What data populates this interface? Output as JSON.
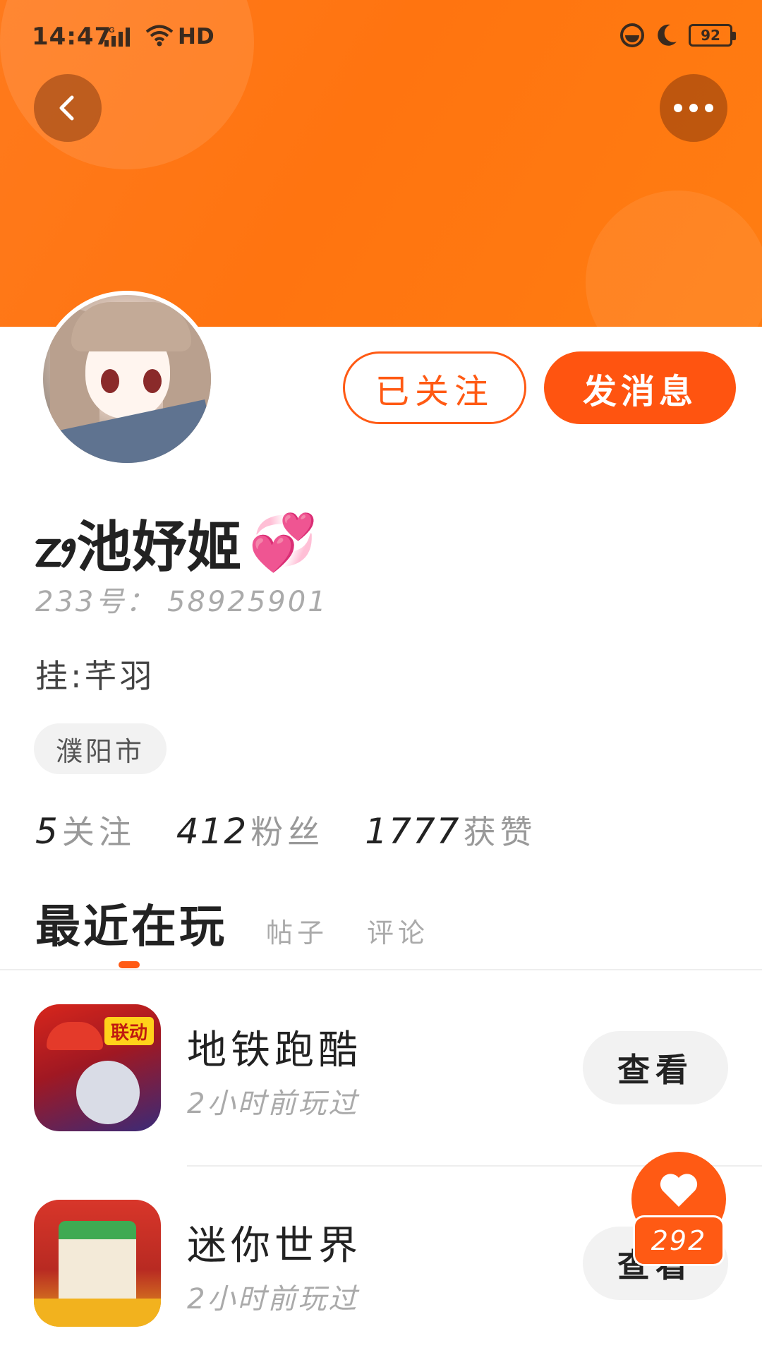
{
  "status_bar": {
    "time": "14:47",
    "network": "4G",
    "hd_label": "HD",
    "battery": "92"
  },
  "header": {
    "back_icon": "chevron-left-icon",
    "more_icon": "more-dots-icon",
    "accent": "#ff7410"
  },
  "profile": {
    "username": "ᤁᤣ池妤姬",
    "username_emoji": "💞",
    "id_line": "233号： 58925901",
    "signature": "挂:芊羽",
    "location": "濮阳市",
    "follow_button": "已关注",
    "message_button": "发消息"
  },
  "stats": [
    {
      "num": "5",
      "label": "关注"
    },
    {
      "num": "412",
      "label": "粉丝"
    },
    {
      "num": "1777",
      "label": "获赞"
    }
  ],
  "tabs": [
    {
      "label": "最近在玩",
      "active": true
    },
    {
      "label": "帖子",
      "active": false
    },
    {
      "label": "评论",
      "active": false
    }
  ],
  "games": [
    {
      "name": "地铁跑酷",
      "time": "2小时前玩过",
      "button": "查看",
      "badge": "联动"
    },
    {
      "name": "迷你世界",
      "time": "2小时前玩过",
      "button": "查看"
    }
  ],
  "like_fab": {
    "icon": "heart-icon",
    "count": "292",
    "color": "#ff5a14"
  }
}
